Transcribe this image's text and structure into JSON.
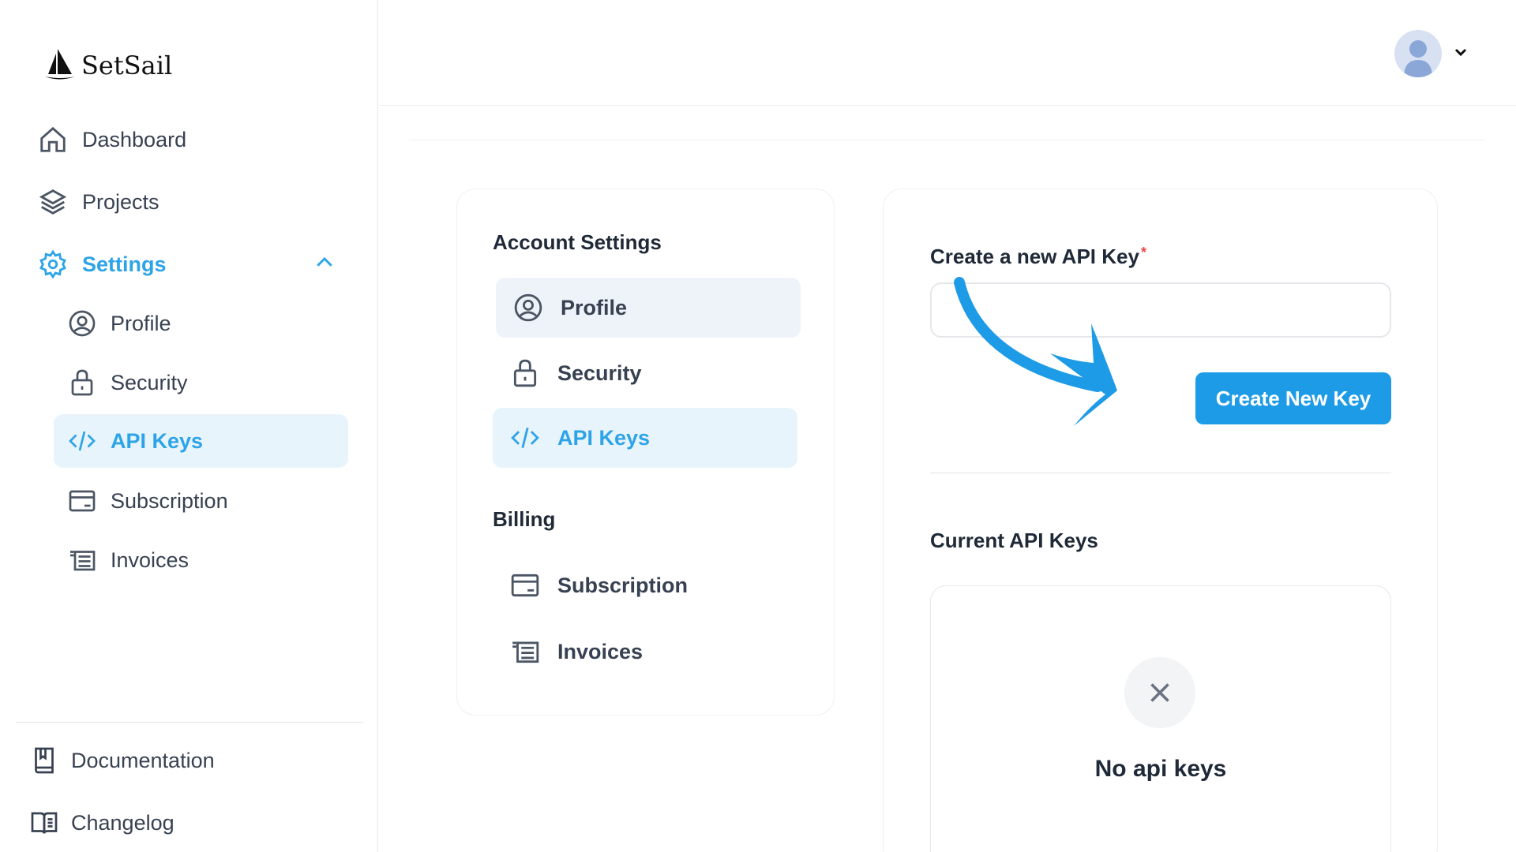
{
  "app": {
    "name": "SetSail"
  },
  "sidebar": {
    "items": [
      {
        "label": "Dashboard",
        "icon": "home-icon"
      },
      {
        "label": "Projects",
        "icon": "layers-icon"
      },
      {
        "label": "Settings",
        "icon": "gear-icon",
        "expanded": true
      }
    ],
    "settings_children": [
      {
        "label": "Profile",
        "icon": "user-circle-icon"
      },
      {
        "label": "Security",
        "icon": "lock-icon"
      },
      {
        "label": "API Keys",
        "icon": "code-icon",
        "active": true
      },
      {
        "label": "Subscription",
        "icon": "card-icon"
      },
      {
        "label": "Invoices",
        "icon": "invoice-icon"
      }
    ],
    "footer": [
      {
        "label": "Documentation",
        "icon": "book-icon"
      },
      {
        "label": "Changelog",
        "icon": "open-book-icon"
      }
    ]
  },
  "settings_menu": {
    "account_title": "Account Settings",
    "account_items": [
      {
        "label": "Profile",
        "icon": "user-circle-icon"
      },
      {
        "label": "Security",
        "icon": "lock-icon"
      },
      {
        "label": "API Keys",
        "icon": "code-icon",
        "active": true
      }
    ],
    "billing_title": "Billing",
    "billing_items": [
      {
        "label": "Subscription",
        "icon": "card-icon"
      },
      {
        "label": "Invoices",
        "icon": "invoice-icon"
      }
    ]
  },
  "api_keys": {
    "create_label": "Create a new API Key",
    "required_mark": "*",
    "input_value": "",
    "create_button": "Create New Key",
    "current_title": "Current API Keys",
    "empty_text": "No api keys"
  },
  "colors": {
    "accent": "#2ea4e8",
    "button": "#1e9be6",
    "required": "#ef4444",
    "active_bg": "#e8f4fc"
  }
}
